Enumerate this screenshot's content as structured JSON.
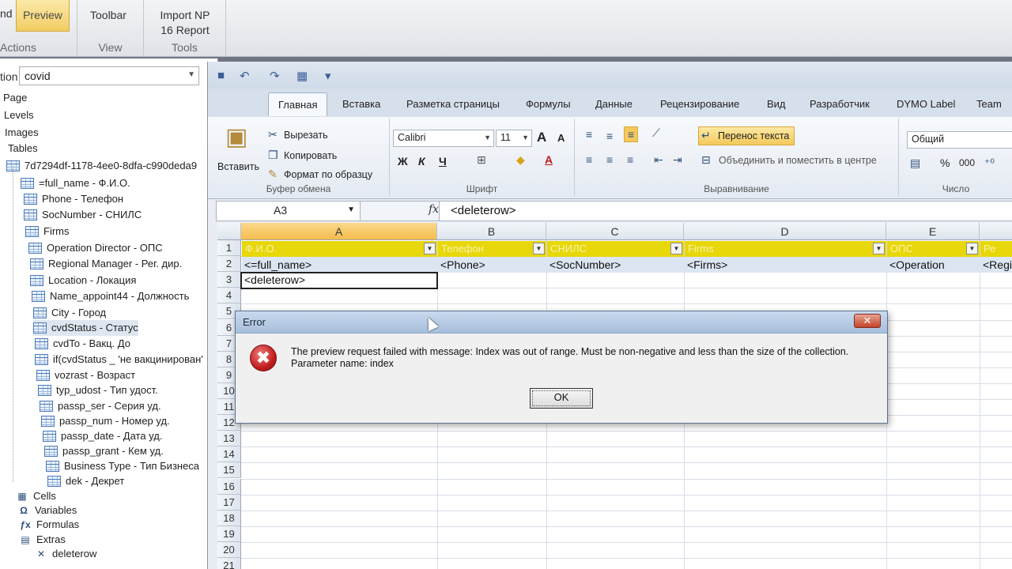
{
  "host_ribbon": {
    "groups": [
      {
        "buttons": [
          "nd",
          "Preview"
        ],
        "caption": "Actions"
      },
      {
        "buttons": [
          "Toolbar"
        ],
        "caption": "View"
      },
      {
        "buttons": [
          "Import NP 16 Report"
        ],
        "caption": "Tools"
      }
    ]
  },
  "left_panel": {
    "datasource_label": "tion",
    "datasource_value": "covid",
    "tree": [
      "Page",
      "Levels",
      "Images",
      "Tables",
      "7d7294df-1178-4ee0-8dfa-c990deda9",
      "=full_name - Ф.И.О.",
      "Phone - Телефон",
      "SocNumber - СНИЛС",
      "Firms",
      "Operation Director - ОПС",
      "Regional Manager - Рег. дир.",
      "Location - Локация",
      "Name_appoint44 - Должность",
      "City - Город",
      "cvdStatus - Статус",
      "cvdTo - Вакц. До",
      "if(cvdStatus _ 'не вакцинирован'",
      "vozrast - Возраст",
      "typ_udost - Тип удост.",
      "passp_ser - Серия уд.",
      "passp_num - Номер уд.",
      "passp_date - Дата уд.",
      "passp_grant - Кем уд.",
      "Business Type - Тип Бизнеса",
      "dek - Декрет",
      "Cells",
      "Variables",
      "Formulas",
      "Extras",
      "deleterow"
    ]
  },
  "excel": {
    "tabs": [
      "Главная",
      "Вставка",
      "Разметка страницы",
      "Формулы",
      "Данные",
      "Рецензирование",
      "Вид",
      "Разработчик",
      "DYMO Label",
      "Team"
    ],
    "clipboard": {
      "paste": "Вставить",
      "cut": "Вырезать",
      "copy": "Копировать",
      "format_painter": "Формат по образцу",
      "caption": "Буфер обмена"
    },
    "font": {
      "name": "Calibri",
      "size": "11",
      "bold": "Ж",
      "italic": "К",
      "underline": "Ч",
      "grow": "A",
      "shrink": "A",
      "color_a": "A",
      "caption": "Шрифт"
    },
    "alignment": {
      "wrap": "Перенос текста",
      "merge": "Объединить и поместить в центре",
      "caption": "Выравнивание"
    },
    "number": {
      "format": "Общий",
      "percent": "%",
      "thousands": "000",
      "caption": "Число"
    },
    "namebox": "A3",
    "fx": "fx",
    "formula": "<deleterow>",
    "columns": [
      "A",
      "B",
      "C",
      "D",
      "E"
    ],
    "header_row": [
      "Ф.И.О.",
      "Телефон",
      "СНИЛС",
      "Firms",
      "ОПС",
      "Ре"
    ],
    "row2": [
      "<=full_name>",
      "<Phone>",
      "<SocNumber>",
      "<Firms>",
      "<Operation",
      "<Regi"
    ],
    "row3": [
      "<deleterow>"
    ],
    "row_numbers": [
      "1",
      "2",
      "3",
      "4",
      "5",
      "6",
      "7",
      "8",
      "9",
      "10",
      "11",
      "12",
      "13",
      "14",
      "15",
      "16",
      "17",
      "18",
      "19",
      "20",
      "21"
    ]
  },
  "dialog": {
    "title": "Error",
    "close": "✕",
    "icon": "✖",
    "line1": "The preview request failed with message: Index was out of range. Must be non-negative and less than the size of the collection.",
    "line2": "Parameter name: index",
    "ok": "OK"
  },
  "colors": {
    "header_yellow": "#e8d70a",
    "accent_blue": "#dce6f2",
    "error_red": "#c21f1f"
  }
}
